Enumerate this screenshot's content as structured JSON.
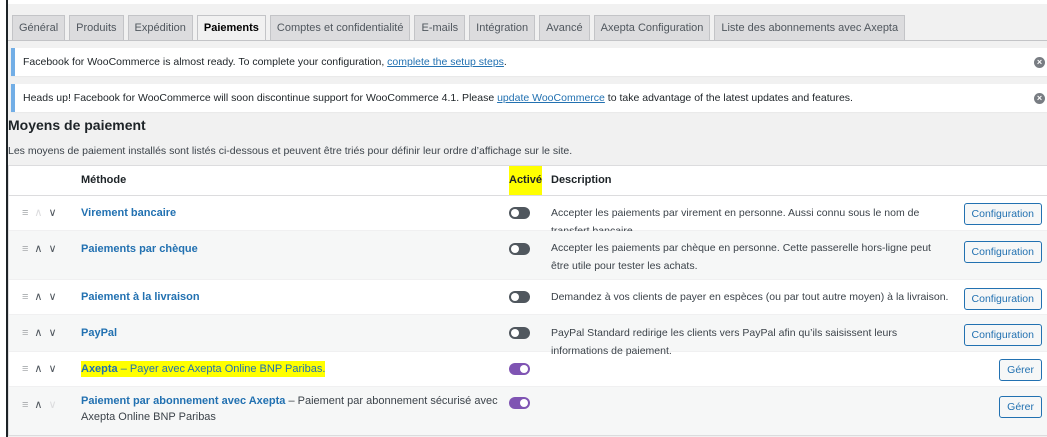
{
  "tabs": [
    {
      "label": "Général",
      "active": false
    },
    {
      "label": "Produits",
      "active": false
    },
    {
      "label": "Expédition",
      "active": false
    },
    {
      "label": "Paiements",
      "active": true
    },
    {
      "label": "Comptes et confidentialité",
      "active": false
    },
    {
      "label": "E-mails",
      "active": false
    },
    {
      "label": "Intégration",
      "active": false
    },
    {
      "label": "Avancé",
      "active": false
    },
    {
      "label": "Axepta Configuration",
      "active": false
    },
    {
      "label": "Liste des abonnements avec Axepta",
      "active": false
    }
  ],
  "notices": [
    {
      "text_before": "Facebook for WooCommerce is almost ready. To complete your configuration, ",
      "link": "complete the setup steps",
      "text_after": ".",
      "dismiss": "×"
    },
    {
      "text_before": "Heads up! Facebook for WooCommerce will soon discontinue support for WooCommerce 4.1. Please ",
      "link": "update WooCommerce",
      "text_after": " to take advantage of the latest updates and features.",
      "dismiss": "×"
    }
  ],
  "section": {
    "title": "Moyens de paiement",
    "intro": "Les moyens de paiement installés sont listés ci-dessous et peuvent être triés pour définir leur ordre d’affichage sur le site."
  },
  "table": {
    "headers": {
      "method": "Méthode",
      "active": "Activé",
      "description": "Description"
    },
    "sort_glyphs": {
      "handle": "≡",
      "up": "∧",
      "down": "∨"
    },
    "rows": [
      {
        "name": "Virement bancaire",
        "extra": "",
        "enabled": false,
        "description": "Accepter les paiements par virement en personne. Aussi connu sous le nom de transfert bancaire.",
        "button": "Configuration"
      },
      {
        "name": "Paiements par chèque",
        "extra": "",
        "enabled": false,
        "description": "Accepter les paiements par chèque en personne. Cette passerelle hors-ligne peut être utile pour tester les achats.",
        "button": "Configuration"
      },
      {
        "name": "Paiement à la livraison",
        "extra": "",
        "enabled": false,
        "description": "Demandez à vos clients de payer en espèces (ou par tout autre moyen) à la livraison.",
        "button": "Configuration"
      },
      {
        "name": "PayPal",
        "extra": "",
        "enabled": false,
        "description": "PayPal Standard redirige les clients vers PayPal afin qu’ils saisissent leurs informations de paiement.",
        "button": "Configuration"
      },
      {
        "name": "Axepta",
        "extra": " – Payer avec Axepta Online BNP Paribas.",
        "enabled": true,
        "description": "",
        "button": "Gérer"
      },
      {
        "name": "Paiement par abonnement avec Axepta",
        "extra": " – Paiement par abonnement sécurisé avec Axepta Online BNP Paribas",
        "enabled": true,
        "description": "",
        "button": "Gérer"
      }
    ]
  },
  "colors": {
    "toggle_on": "#7f54b3",
    "toggle_off": "#50575e",
    "link": "#2271b1",
    "highlight": "#ffff00"
  }
}
